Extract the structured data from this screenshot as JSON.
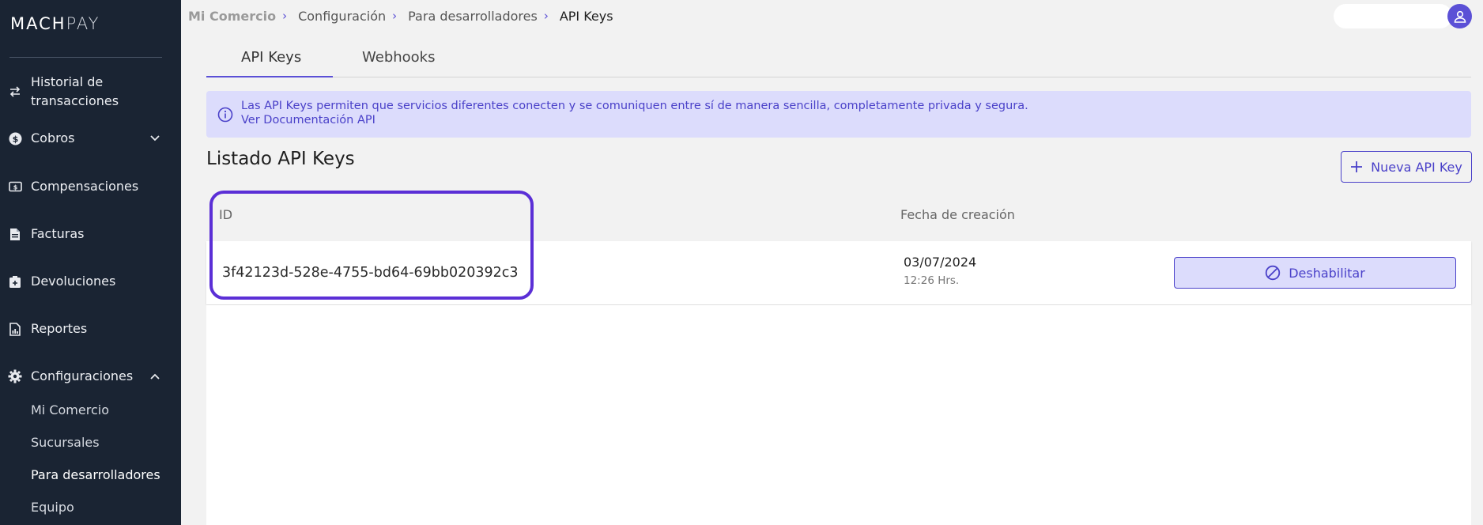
{
  "app": {
    "logo_bold": "MACH",
    "logo_thin": "PAY"
  },
  "sidebar": {
    "items": [
      {
        "label_line1": "Historial de",
        "label_line2": "transacciones",
        "icon": "swap-arrows-icon"
      },
      {
        "label": "Cobros",
        "icon": "dollar-coin-icon",
        "expanded": false
      },
      {
        "label": "Compensaciones",
        "icon": "cash-bill-icon"
      },
      {
        "label": "Facturas",
        "icon": "document-icon"
      },
      {
        "label": "Devoluciones",
        "icon": "return-box-icon"
      },
      {
        "label": "Reportes",
        "icon": "chart-report-icon"
      },
      {
        "label": "Configuraciones",
        "icon": "gear-icon",
        "expanded": true
      }
    ],
    "subitems": [
      {
        "label": "Mi Comercio"
      },
      {
        "label": "Sucursales"
      },
      {
        "label": "Para desarrolladores",
        "active": true
      },
      {
        "label": "Equipo"
      }
    ]
  },
  "breadcrumb": {
    "items": [
      "Mi Comercio",
      "Configuración",
      "Para desarrolladores",
      "API Keys"
    ],
    "separator": "›"
  },
  "tabs": [
    {
      "label": "API Keys",
      "active": true
    },
    {
      "label": "Webhooks",
      "active": false
    }
  ],
  "info": {
    "text": "Las API Keys permiten que servicios diferentes conecten y se comuniquen entre sí de manera sencilla, completamente privada y segura.",
    "link": "Ver Documentación API"
  },
  "list": {
    "title": "Listado API Keys",
    "new_button": "Nueva API Key",
    "columns": {
      "id": "ID",
      "created": "Fecha de creación"
    },
    "rows": [
      {
        "id": "3f42123d-528e-4755-bd64-69bb020392c3",
        "date": "03/07/2024",
        "time": "12:26 Hrs.",
        "action": "Deshabilitar"
      }
    ]
  },
  "colors": {
    "sidebar_bg": "#1a2433",
    "accent": "#5b50d6",
    "accent_text": "#4a41c9",
    "info_bg": "#dcdcfc",
    "highlight": "#5b2fd6"
  }
}
